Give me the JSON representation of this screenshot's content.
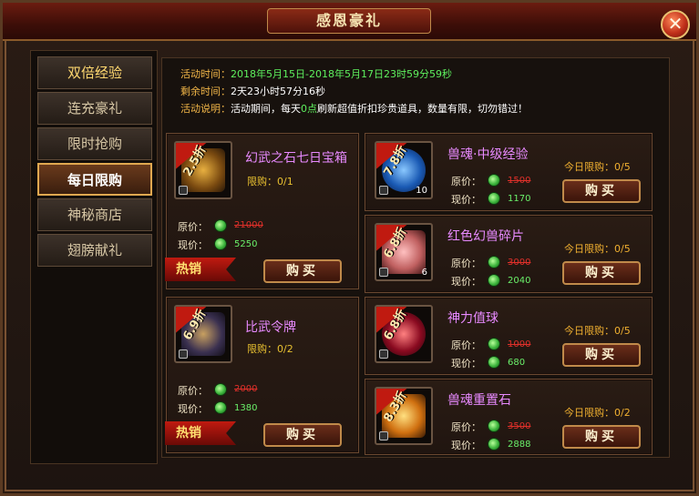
{
  "window": {
    "title": "感恩豪礼",
    "close_label": "✕"
  },
  "tabs": [
    {
      "label": "双倍经验"
    },
    {
      "label": "连充豪礼"
    },
    {
      "label": "限时抢购"
    },
    {
      "label": "每日限购"
    },
    {
      "label": "神秘商店"
    },
    {
      "label": "翅膀献礼"
    }
  ],
  "info": {
    "time_label": "活动时间：",
    "time_value": "2018年5月15日-2018年5月17日23时59分59秒",
    "remain_label": "剩余时间：",
    "remain_value": "2天23小时57分16秒",
    "desc_label": "活动说明：",
    "desc_pre": "活动期间，每天",
    "desc_hl": "0点",
    "desc_post": "刷新超值折扣珍贵道具，数量有限，切勿错过！"
  },
  "labels": {
    "orig": "原价：",
    "cur": "现价：",
    "buy": "购买",
    "hot": "热销"
  },
  "items_left": [
    {
      "discount": "2.5折",
      "name": "幻武之石七日宝箱",
      "limit": "限购：0/1",
      "orig_price": "21000",
      "cur_price": "5250",
      "hot": true
    },
    {
      "discount": "6.9折",
      "name": "比武令牌",
      "limit": "限购：0/2",
      "orig_price": "2000",
      "cur_price": "1380",
      "hot": true
    }
  ],
  "items_right": [
    {
      "discount": "7.8折",
      "name": "兽魂·中级经验",
      "limit": "今日限购：0/5",
      "orig_price": "1500",
      "cur_price": "1170",
      "qty": "10"
    },
    {
      "discount": "6.8折",
      "name": "红色幻兽碎片",
      "limit": "今日限购：0/5",
      "orig_price": "3000",
      "cur_price": "2040",
      "qty": "6"
    },
    {
      "discount": "6.8折",
      "name": "神力值球",
      "limit": "今日限购：0/5",
      "orig_price": "1000",
      "cur_price": "680",
      "qty": ""
    },
    {
      "discount": "8.3折",
      "name": "兽魂重置石",
      "limit": "今日限购：0/2",
      "orig_price": "3500",
      "cur_price": "2888",
      "qty": ""
    }
  ],
  "colors": {
    "accent_gold": "#e0a850",
    "price_green": "#6af06a",
    "orig_red": "#e0302a",
    "name_purple": "#e88aff"
  }
}
